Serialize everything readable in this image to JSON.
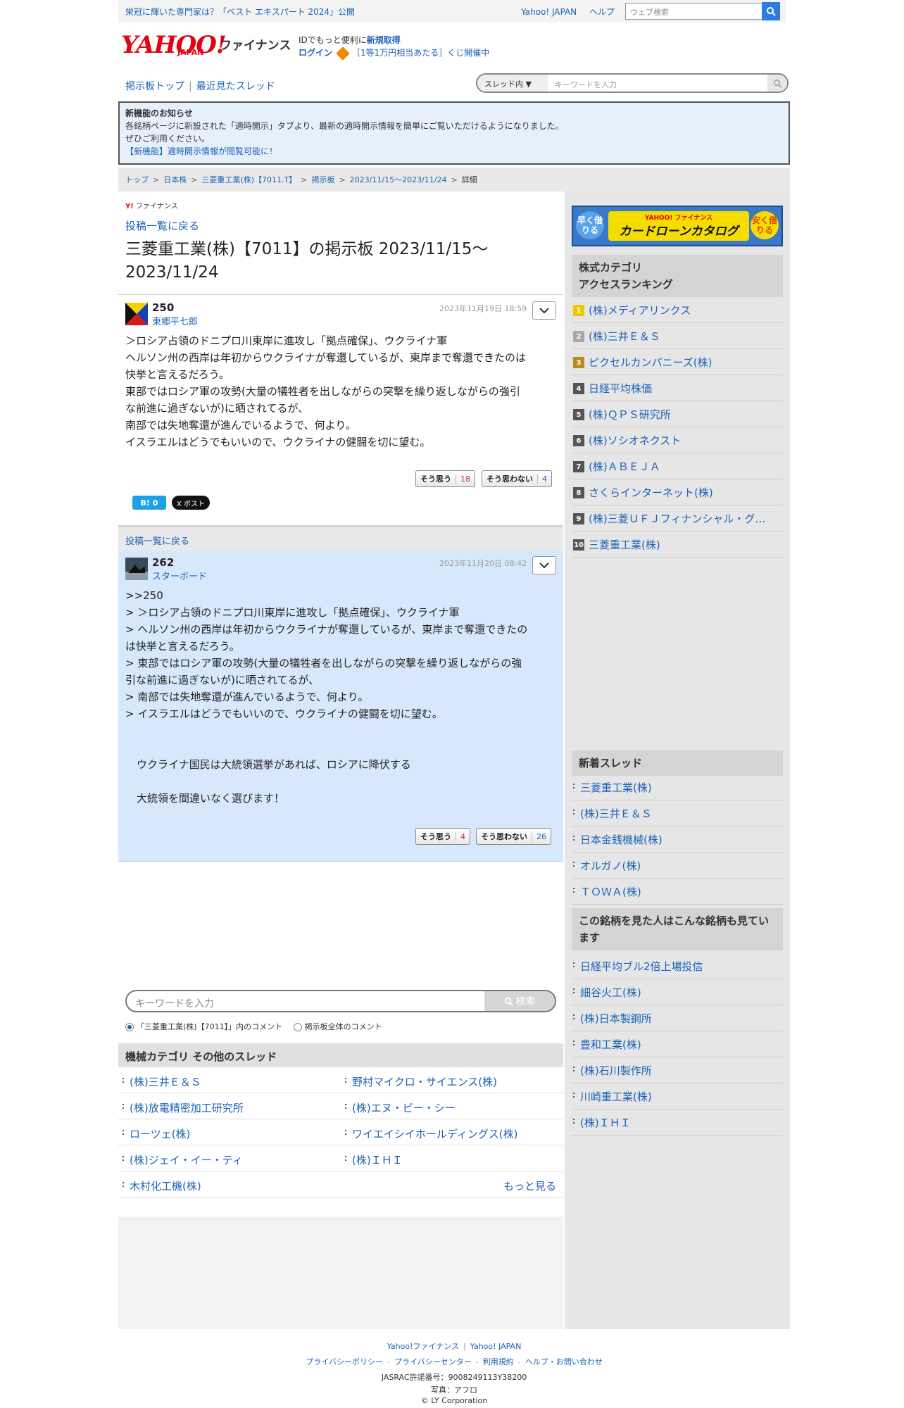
{
  "topbar": {
    "promo": "栄冠に輝いた専門家は？「ベスト エキスパート 2024」公開",
    "links": [
      "Yahoo! JAPAN",
      "ヘルプ"
    ],
    "web_search_placeholder": "ウェブ検索"
  },
  "header": {
    "logo_text": "YAHOO!",
    "logo_sub": "JAPAN",
    "logo_service": "ファイナンス",
    "id_text": "IDでもっと便利に",
    "id_link": "新規取得",
    "login": "ログイン",
    "lottery": "［1等1万円相当あたる］くじ開催中"
  },
  "nav": {
    "board_top": "掲示板トップ",
    "recent": "最近見たスレッド",
    "search_scope": "スレッド内",
    "search_placeholder": "キーワードを入力"
  },
  "notice": {
    "title": "新機能のお知らせ",
    "line1": "各銘柄ページに新設された「適時開示」タブより、最新の適時開示情報を簡単にご覧いただけるようになりました。",
    "line2": "ぜひご利用ください。",
    "link": "【新機能】適時開示情報が閲覧可能に！"
  },
  "breadcrumb": [
    "トップ",
    "日本株",
    "三菱重工業(株)【7011.T】",
    "掲示板",
    "2023/11/15〜2023/11/24",
    "詳細"
  ],
  "main": {
    "brand_small": "ファイナンス",
    "back_label": "投稿一覧に戻る",
    "title": "三菱重工業(株)【7011】の掲示板 2023/11/15〜2023/11/24"
  },
  "posts": [
    {
      "number": "250",
      "author": "東郷平七郎",
      "date": "2023年11月19日 18:59",
      "lines": [
        "＞ロシア占領のドニプロ川東岸に進攻し「拠点確保」、ウクライナ軍",
        "ヘルソン州の西岸は年初からウクライナが奪還しているが、東岸まで奪還できたのは",
        "快挙と言えるだろう。",
        "東部ではロシア軍の攻勢(大量の犠牲者を出しながらの突撃を繰り返しながらの強引",
        "な前進に過ぎないが)に晒されてるが、",
        "南部では失地奪還が進んでいるようで、何より。",
        "イスラエルはどうでもいいので、ウクライナの健闘を切に望む。"
      ],
      "agree_label": "そう思う",
      "agree": "18",
      "disagree_label": "そう思わない",
      "disagree": "4"
    },
    {
      "number": "262",
      "author": "スターボード",
      "date": "2023年11月20日 08:42",
      "lines": [
        ">>250",
        "> ＞ロシア占領のドニプロ川東岸に進攻し「拠点確保」、ウクライナ軍",
        "> ヘルソン州の西岸は年初からウクライナが奪還しているが、東岸まで奪還できたの",
        "は快挙と言えるだろう。",
        "> 東部ではロシア軍の攻勢(大量の犠牲者を出しながらの突撃を繰り返しながらの強",
        "引な前進に過ぎないが)に晒されてるが、",
        "> 南部では失地奪還が進んでいるようで、何より。",
        "> イスラエルはどうでもいいので、ウクライナの健闘を切に望む。"
      ],
      "extra1": "ウクライナ国民は大統領選挙があれば、ロシアに降伏する",
      "extra2": "大統領を間違いなく選びます！",
      "agree_label": "そう思う",
      "agree": "4",
      "disagree_label": "そう思わない",
      "disagree": "26"
    }
  ],
  "share": {
    "hatena": "B! 0",
    "x": "X ポスト"
  },
  "comment_search": {
    "placeholder": "キーワードを入力",
    "button": "検索",
    "option_thread": "「三菱重工業(株)【7011】」内のコメント",
    "option_all": "掲示板全体のコメント"
  },
  "category": {
    "title": "機械カテゴリ その他のスレッド",
    "items": [
      "(株)三井Ｅ＆Ｓ",
      "野村マイクロ・サイエンス(株)",
      "(株)放電精密加工研究所",
      "(株)エヌ・ピー・シー",
      "ローツェ(株)",
      "ワイエイシイホールディングス(株)",
      "(株)ジェイ・イー・ティ",
      "(株)ＩＨＩ",
      "木村化工機(株)"
    ],
    "more": "もっと見る"
  },
  "side": {
    "banner_left": "早く借りる",
    "banner_brand": "YAHOO! ファイナンス",
    "banner_title": "カードローンカタログ",
    "banner_right": "安く借りる",
    "ranking_title1": "株式カテゴリ",
    "ranking_title2": "アクセスランキング",
    "ranking": [
      {
        "rank": "1",
        "name": "(株)メディアリンクス",
        "color": "#f0c800"
      },
      {
        "rank": "2",
        "name": "(株)三井Ｅ＆Ｓ",
        "color": "#a8a8a8"
      },
      {
        "rank": "3",
        "name": "ピクセルカンパニーズ(株)",
        "color": "#b88a20"
      },
      {
        "rank": "4",
        "name": "日経平均株価",
        "color": "#555555"
      },
      {
        "rank": "5",
        "name": "(株)ＱＰＳ研究所",
        "color": "#555555"
      },
      {
        "rank": "6",
        "name": "(株)ソシオネクスト",
        "color": "#555555"
      },
      {
        "rank": "7",
        "name": "(株)ＡＢＥＪＡ",
        "color": "#555555"
      },
      {
        "rank": "8",
        "name": "さくらインターネット(株)",
        "color": "#555555"
      },
      {
        "rank": "9",
        "name": "(株)三菱ＵＦＪフィナンシャル・グ…",
        "color": "#555555"
      },
      {
        "rank": "10",
        "name": "三菱重工業(株)",
        "color": "#555555"
      }
    ],
    "new_title": "新着スレッド",
    "new_threads": [
      "三菱重工業(株)",
      "(株)三井Ｅ＆Ｓ",
      "日本金銭機械(株)",
      "オルガノ(株)",
      "ＴＯＷＡ(株)"
    ],
    "also_title": "この銘柄を見た人はこんな銘柄も見ています",
    "also_list": [
      "日経平均ブル2倍上場投信",
      "細谷火工(株)",
      "(株)日本製鋼所",
      "豊和工業(株)",
      "(株)石川製作所",
      "川崎重工業(株)",
      "(株)ＩＨＩ"
    ]
  },
  "footer": {
    "row1": [
      "Yahoo!ファイナンス",
      "Yahoo! JAPAN"
    ],
    "row2": [
      "プライバシーポリシー",
      "プライバシーセンター",
      "利用規約",
      "ヘルプ・お問い合わせ"
    ],
    "jasrac": "JASRAC許諾番号：9008249113Y38200",
    "photo": "写真：アフロ",
    "copyright": "© LY Corporation"
  }
}
